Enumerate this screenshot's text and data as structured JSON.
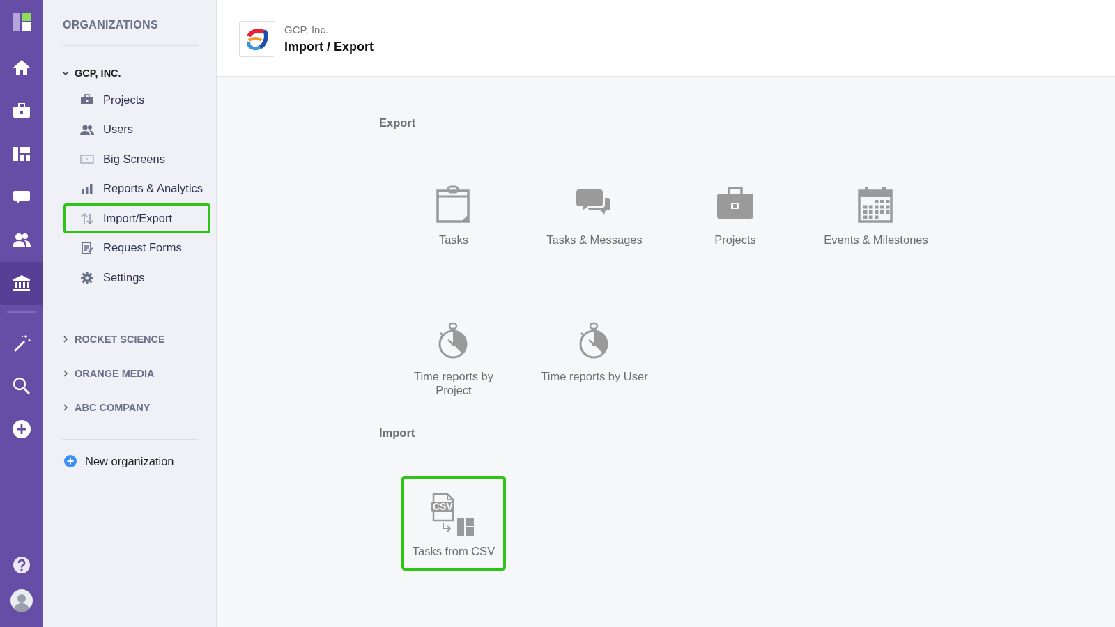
{
  "rail": {
    "items": [
      {
        "kind": "home",
        "selected": false
      },
      {
        "kind": "briefcase",
        "selected": false
      },
      {
        "kind": "board",
        "selected": false
      },
      {
        "kind": "chat",
        "selected": false
      },
      {
        "kind": "users",
        "selected": false
      },
      {
        "kind": "bank",
        "selected": true
      }
    ],
    "tools": [
      {
        "kind": "wand",
        "selected": false
      },
      {
        "kind": "search",
        "selected": false
      },
      {
        "kind": "plus",
        "selected": false
      }
    ],
    "bottom": [
      {
        "kind": "help"
      },
      {
        "kind": "avatar"
      }
    ]
  },
  "sidebar": {
    "heading": "ORGANIZATIONS",
    "organizations": [
      {
        "name": "GCP, INC.",
        "expanded": true,
        "items": [
          {
            "label": "Projects",
            "kind": "briefcase",
            "highlighted": false
          },
          {
            "label": "Users",
            "kind": "users",
            "highlighted": false
          },
          {
            "label": "Big Screens",
            "kind": "screen",
            "highlighted": false
          },
          {
            "label": "Reports & Analytics",
            "kind": "bars",
            "highlighted": false
          },
          {
            "label": "Import/Export",
            "kind": "arrows",
            "highlighted": true
          },
          {
            "label": "Request Forms",
            "kind": "form",
            "highlighted": false
          },
          {
            "label": "Settings",
            "kind": "gear",
            "highlighted": false
          }
        ]
      },
      {
        "name": "ROCKET SCIENCE",
        "expanded": false
      },
      {
        "name": "ORANGE MEDIA",
        "expanded": false
      },
      {
        "name": "ABC COMPANY",
        "expanded": false
      }
    ],
    "new_organization": "New organization"
  },
  "header": {
    "organization": "GCP, Inc.",
    "title": "Import / Export"
  },
  "sections": [
    {
      "heading": "Export",
      "items": [
        {
          "label": "Tasks",
          "kind": "clipboard",
          "highlighted": false
        },
        {
          "label": "Tasks & Messages",
          "kind": "chat",
          "highlighted": false
        },
        {
          "label": "Projects",
          "kind": "briefcase",
          "highlighted": false
        },
        {
          "label": "Events & Milestones",
          "kind": "calendar",
          "highlighted": false
        },
        {
          "label": "Time reports by Project",
          "kind": "stopwatch",
          "highlighted": false
        },
        {
          "label": "Time reports by User",
          "kind": "stopwatch",
          "highlighted": false
        }
      ]
    },
    {
      "heading": "Import",
      "items": [
        {
          "label": "Tasks from CSV",
          "kind": "csv",
          "highlighted": true,
          "badge": "CSV"
        }
      ]
    }
  ]
}
